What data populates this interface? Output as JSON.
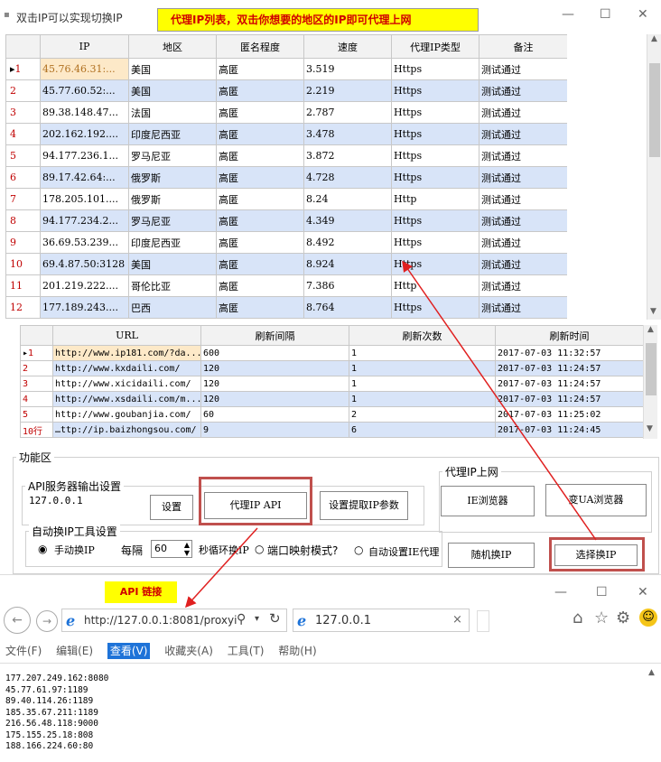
{
  "window": {
    "title": "双击IP可以实现切换IP",
    "banner": "代理IP列表，双击你想要的地区的IP即可代理上网",
    "minimize": "—",
    "maximize": "☐",
    "close": "✕"
  },
  "ip_table": {
    "headers": [
      "",
      "IP",
      "地区",
      "匿名程度",
      "速度",
      "代理IP类型",
      "备注"
    ],
    "rows": [
      {
        "n": "1",
        "ip": "45.76.46.31:...",
        "region": "美国",
        "anon": "高匿",
        "speed": "3.519",
        "type": "Https",
        "note": "测试通过"
      },
      {
        "n": "2",
        "ip": "45.77.60.52:...",
        "region": "美国",
        "anon": "高匿",
        "speed": "2.219",
        "type": "Https",
        "note": "测试通过"
      },
      {
        "n": "3",
        "ip": "89.38.148.47...",
        "region": "法国",
        "anon": "高匿",
        "speed": "2.787",
        "type": "Https",
        "note": "测试通过"
      },
      {
        "n": "4",
        "ip": "202.162.192....",
        "region": "印度尼西亚",
        "anon": "高匿",
        "speed": "3.478",
        "type": "Https",
        "note": "测试通过"
      },
      {
        "n": "5",
        "ip": "94.177.236.1...",
        "region": "罗马尼亚",
        "anon": "高匿",
        "speed": "3.872",
        "type": "Https",
        "note": "测试通过"
      },
      {
        "n": "6",
        "ip": "89.17.42.64:...",
        "region": "俄罗斯",
        "anon": "高匿",
        "speed": "4.728",
        "type": "Https",
        "note": "测试通过"
      },
      {
        "n": "7",
        "ip": "178.205.101....",
        "region": "俄罗斯",
        "anon": "高匿",
        "speed": "8.24",
        "type": "Http",
        "note": "测试通过"
      },
      {
        "n": "8",
        "ip": "94.177.234.2...",
        "region": "罗马尼亚",
        "anon": "高匿",
        "speed": "4.349",
        "type": "Https",
        "note": "测试通过"
      },
      {
        "n": "9",
        "ip": "36.69.53.239...",
        "region": "印度尼西亚",
        "anon": "高匿",
        "speed": "8.492",
        "type": "Https",
        "note": "测试通过"
      },
      {
        "n": "10",
        "ip": "69.4.87.50:3128",
        "region": "美国",
        "anon": "高匿",
        "speed": "8.924",
        "type": "Https",
        "note": "测试通过"
      },
      {
        "n": "11",
        "ip": "201.219.222....",
        "region": "哥伦比亚",
        "anon": "高匿",
        "speed": "7.386",
        "type": "Http",
        "note": "测试通过"
      },
      {
        "n": "12",
        "ip": "177.189.243....",
        "region": "巴西",
        "anon": "高匿",
        "speed": "8.764",
        "type": "Https",
        "note": "测试通过"
      }
    ]
  },
  "url_table": {
    "headers": [
      "",
      "URL",
      "刷新间隔",
      "刷新次数",
      "刷新时间"
    ],
    "rows": [
      {
        "n": "1",
        "url": "http://www.ip181.com/?da...",
        "interval": "600",
        "count": "1",
        "time": "2017-07-03 11:32:57"
      },
      {
        "n": "2",
        "url": "http://www.kxdaili.com/",
        "interval": "120",
        "count": "1",
        "time": "2017-07-03 11:24:57"
      },
      {
        "n": "3",
        "url": "http://www.xicidaili.com/",
        "interval": "120",
        "count": "1",
        "time": "2017-07-03 11:24:57"
      },
      {
        "n": "4",
        "url": "http://www.xsdaili.com/m...",
        "interval": "120",
        "count": "1",
        "time": "2017-07-03 11:24:57"
      },
      {
        "n": "5",
        "url": "http://www.goubanjia.com/",
        "interval": "60",
        "count": "2",
        "time": "2017-07-03 11:25:02"
      },
      {
        "n": "10行",
        "url": "…ttp://ip.baizhongsou.com/",
        "interval": "9",
        "count": "6",
        "time": "2017-07-03 11:24:45"
      }
    ]
  },
  "functions": {
    "group_label": "功能区",
    "api_group_label": "API服务器输出设置",
    "api_host": "127.0.0.1",
    "settings_button": "设置",
    "proxy_api_button": "代理IP API",
    "extract_params_button": "设置提取IP参数",
    "proxy_net_label": "代理IP上网",
    "ie_browser_button": "IE浏览器",
    "ua_browser_button": "变UA浏览器",
    "auto_switch_label": "自动换IP工具设置",
    "manual_switch": "手动换IP",
    "every_label": "每隔",
    "interval_value": "60",
    "seconds_label": "秒循环换IP",
    "port_mapping": "端口映射模式?",
    "auto_ie_proxy": "自动设置IE代理",
    "random_switch_button": "随机换IP",
    "select_switch_button": "选择换IP"
  },
  "browser": {
    "api_link_label": "API 链接",
    "address": "http://127.0.0.1:8081/proxyi",
    "tab_title": "127.0.0.1",
    "tab_close": "×",
    "menu": [
      "文件(F)",
      "编辑(E)",
      "查看(V)",
      "收藏夹(A)",
      "工具(T)",
      "帮助(H)"
    ],
    "active_menu": "查看(V)",
    "content_lines": [
      "177.207.249.162:8080",
      "45.77.61.97:1189",
      "89.40.114.26:1189",
      "185.35.67.211:1189",
      "216.56.48.118:9000",
      "175.155.25.18:808",
      "188.166.224.60:80"
    ]
  },
  "colors": {
    "banner_bg": "#ffff00",
    "banner_text": "#d00000",
    "alt_row": "#d8e4f8",
    "highlight_box": "#c0504d",
    "arrow": "#e02020"
  }
}
